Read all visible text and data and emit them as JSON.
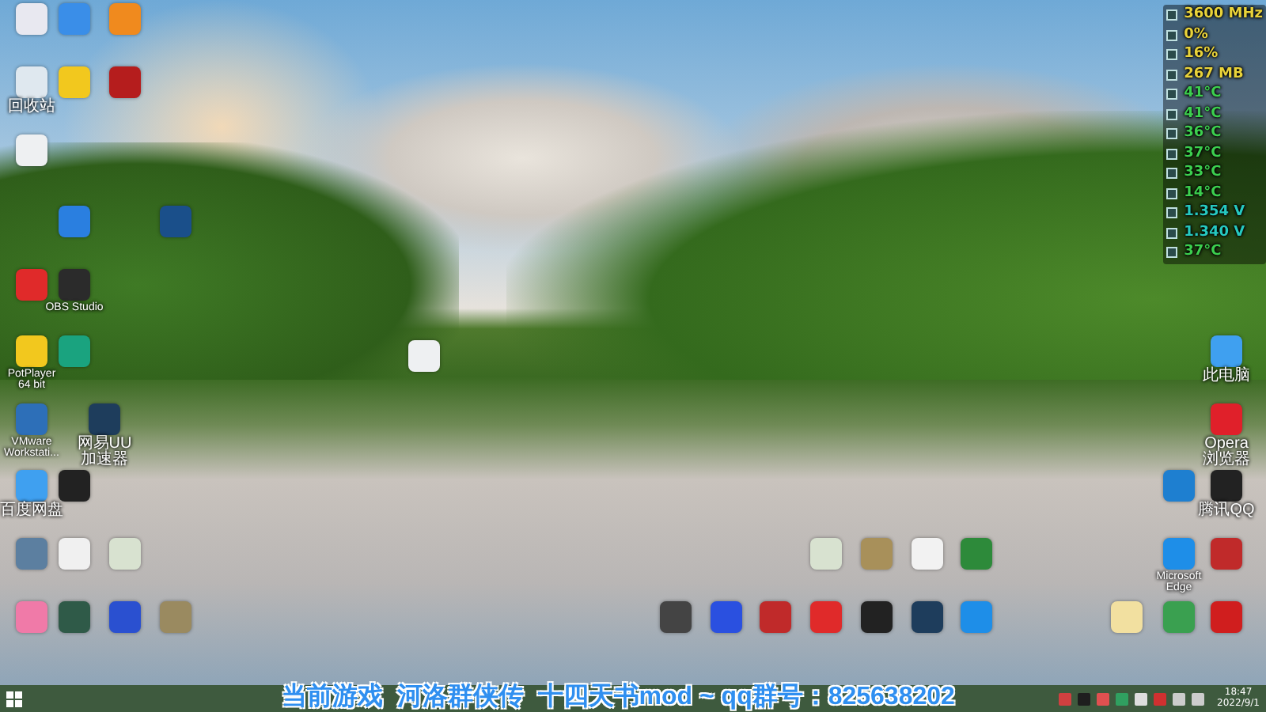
{
  "desktop_icons": [
    {
      "label": "回收站"
    },
    {
      "label": "OBS Studio"
    },
    {
      "label": "PotPlayer 64 bit"
    },
    {
      "label": "VMware Workstati..."
    },
    {
      "label": "网易UU加速器"
    },
    {
      "label": "百度网盘"
    },
    {
      "label": "此电脑"
    },
    {
      "label": "Opera 浏览器"
    },
    {
      "label": "腾讯QQ"
    },
    {
      "label": "Microsoft Edge"
    }
  ],
  "sensor_readings": [
    {
      "text": "3600 MHz",
      "color": "#e8d23a"
    },
    {
      "text": "0%",
      "color": "#e8d23a"
    },
    {
      "text": "16%",
      "color": "#e8d23a"
    },
    {
      "text": "267 MB",
      "color": "#e8d23a"
    },
    {
      "text": "41°C",
      "color": "#3ccf4e"
    },
    {
      "text": "41°C",
      "color": "#3ccf4e"
    },
    {
      "text": "36°C",
      "color": "#3ccf4e"
    },
    {
      "text": "37°C",
      "color": "#3ccf4e"
    },
    {
      "text": "33°C",
      "color": "#3ccf4e"
    },
    {
      "text": "14°C",
      "color": "#3ccf4e"
    },
    {
      "text": "1.354 V",
      "color": "#26c9c0"
    },
    {
      "text": "1.340 V",
      "color": "#26c9c0"
    },
    {
      "text": "37°C",
      "color": "#3ccf4e"
    }
  ],
  "overlay_caption": "当前游戏  河洛群侠传  十四天书mod ~ qq群号：825638202",
  "taskbar": {
    "time": "18:47",
    "date": "2022/9/1"
  }
}
